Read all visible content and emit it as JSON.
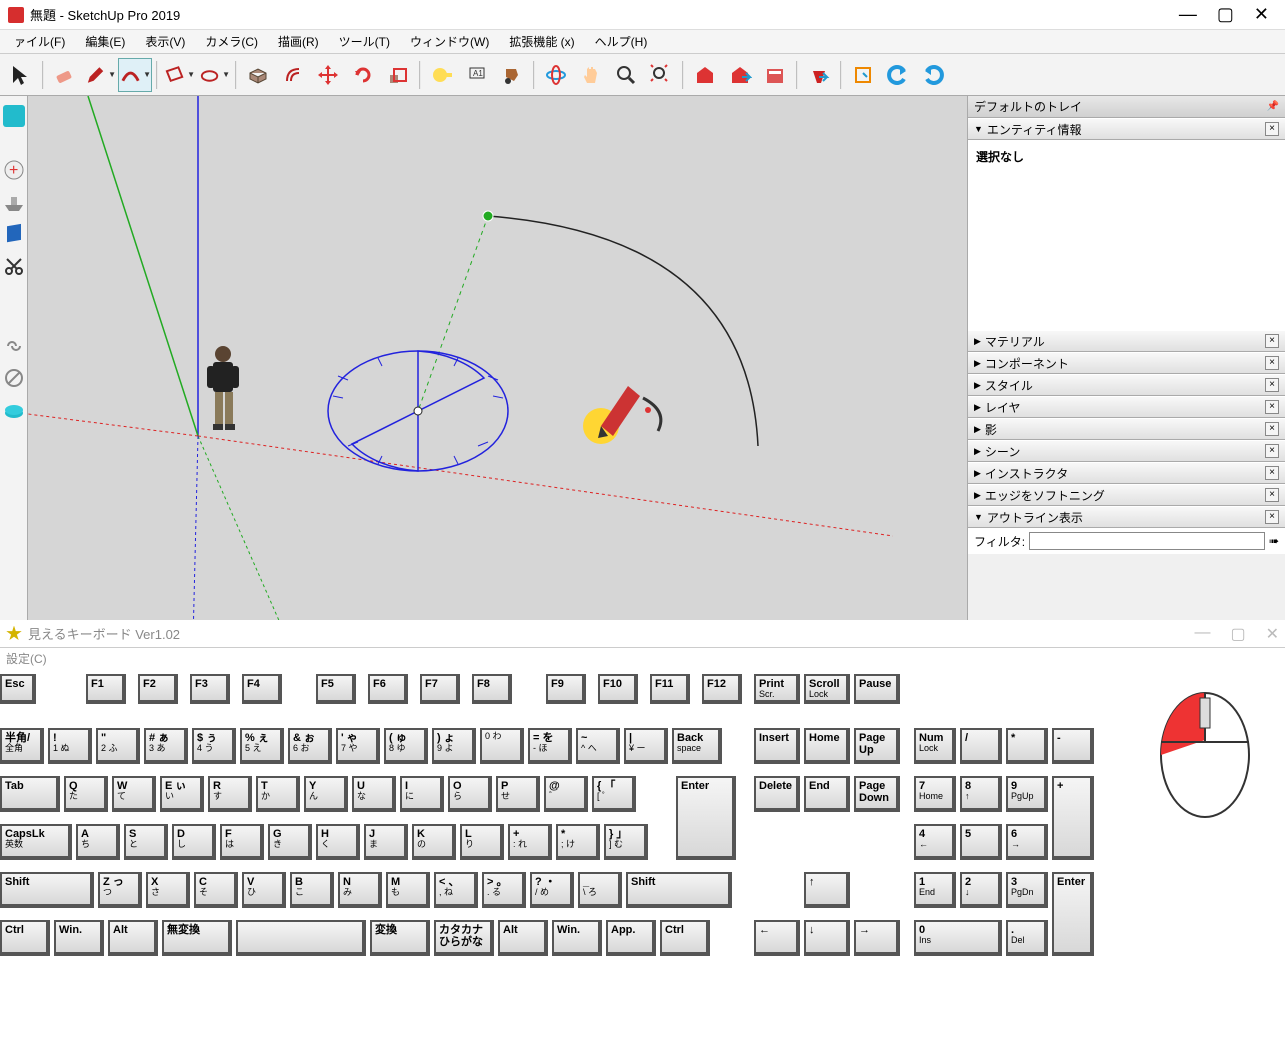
{
  "window": {
    "title": "無題 - SketchUp Pro 2019",
    "min": "—",
    "max": "▢",
    "close": "✕"
  },
  "menus": [
    {
      "id": "file",
      "label": "ァイル(F)"
    },
    {
      "id": "edit",
      "label": "編集(E)"
    },
    {
      "id": "view",
      "label": "表示(V)"
    },
    {
      "id": "camera",
      "label": "カメラ(C)"
    },
    {
      "id": "draw",
      "label": "描画(R)"
    },
    {
      "id": "tools",
      "label": "ツール(T)"
    },
    {
      "id": "window",
      "label": "ウィンドウ(W)"
    },
    {
      "id": "ext",
      "label": "拡張機能 (x)"
    },
    {
      "id": "help",
      "label": "ヘルプ(H)"
    }
  ],
  "tray": {
    "title": "デフォルトのトレイ",
    "entity_head": "エンティティ情報",
    "entity_body": "選択なし",
    "panels": [
      "マテリアル",
      "コンポーネント",
      "スタイル",
      "レイヤ",
      "影",
      "シーン",
      "インストラクタ",
      "エッジをソフトニング"
    ],
    "outline_head": "アウトライン表示",
    "filter": "フィルタ:"
  },
  "kb": {
    "title": "見えるキーボード Ver1.02",
    "menu": "設定(C)",
    "row_f": [
      "Esc",
      "F1",
      "F2",
      "F3",
      "F4",
      "F5",
      "F6",
      "F7",
      "F8",
      "F9",
      "F10",
      "F11",
      "F12"
    ],
    "row_f_right": [
      [
        "Print",
        "Scr."
      ],
      [
        "Scroll",
        "Lock"
      ],
      [
        "Pause",
        ""
      ]
    ],
    "row1": [
      [
        "半角/",
        "全角"
      ],
      [
        "!",
        "1 ぬ"
      ],
      [
        "\"",
        "2 ふ"
      ],
      [
        "# ぁ",
        "3 あ"
      ],
      [
        "$ ぅ",
        "4 う"
      ],
      [
        "% ぇ",
        "5 え"
      ],
      [
        "& ぉ",
        "6 お"
      ],
      [
        "' ゃ",
        "7 や"
      ],
      [
        "( ゅ",
        "8 ゆ"
      ],
      [
        ") ょ",
        "9 よ"
      ],
      [
        "",
        "0 わ"
      ],
      [
        "= を",
        "- ほ"
      ],
      [
        "~",
        "^ へ"
      ],
      [
        "|",
        "¥ ー"
      ]
    ],
    "backspace": [
      "Back",
      "space"
    ],
    "row1_nav": [
      "Insert",
      "Home",
      "Page\nUp"
    ],
    "row1_np": [
      [
        "Num",
        "Lock"
      ],
      [
        "/",
        ""
      ],
      [
        "*",
        ""
      ],
      [
        "-",
        ""
      ]
    ],
    "row2": [
      "Tab"
    ],
    "row2_keys": [
      [
        "Q",
        "た"
      ],
      [
        "W",
        "て"
      ],
      [
        "E ぃ",
        "い"
      ],
      [
        "R",
        "す"
      ],
      [
        "T",
        "か"
      ],
      [
        "Y",
        "ん"
      ],
      [
        "U",
        "な"
      ],
      [
        "I",
        "に"
      ],
      [
        "O",
        "ら"
      ],
      [
        "P",
        "せ"
      ],
      [
        "@",
        "゛"
      ],
      [
        "{ 「",
        "[  ゜"
      ]
    ],
    "enter": "Enter",
    "row2_nav": [
      "Delete",
      "End",
      "Page\nDown"
    ],
    "row2_np": [
      [
        "7",
        "Home"
      ],
      [
        "8",
        "↑"
      ],
      [
        "9",
        "PgUp"
      ]
    ],
    "row3": [
      [
        "CapsLk",
        "英数"
      ]
    ],
    "row3_keys": [
      [
        "A",
        "ち"
      ],
      [
        "S",
        "と"
      ],
      [
        "D",
        "し"
      ],
      [
        "F",
        "は"
      ],
      [
        "G",
        "き"
      ],
      [
        "H",
        "く"
      ],
      [
        "J",
        "ま"
      ],
      [
        "K",
        "の"
      ],
      [
        "L",
        "り"
      ],
      [
        "+",
        ": れ"
      ],
      [
        "*",
        "; け"
      ],
      [
        "} 」",
        "] む"
      ]
    ],
    "row3_np": [
      [
        "4",
        "←"
      ],
      [
        "5",
        ""
      ],
      [
        "6",
        "→"
      ]
    ],
    "np_plus": "+",
    "row4": [
      "Shift"
    ],
    "row4_keys": [
      [
        "Z っ",
        "つ"
      ],
      [
        "X",
        "さ"
      ],
      [
        "C",
        "そ"
      ],
      [
        "V",
        "ひ"
      ],
      [
        "B",
        "こ"
      ],
      [
        "N",
        "み"
      ],
      [
        "M",
        "も"
      ],
      [
        "< 、",
        ", ね"
      ],
      [
        "> 。",
        ". る"
      ],
      [
        "? ・",
        "/ め"
      ],
      [
        "_",
        "\\ ろ"
      ]
    ],
    "row4_r": "Shift",
    "row4_nav": "↑",
    "row4_np": [
      [
        "1",
        "End"
      ],
      [
        "2",
        "↓"
      ],
      [
        "3",
        "PgDn"
      ]
    ],
    "np_enter": "Enter",
    "row5": [
      "Ctrl",
      "Win.",
      "Alt",
      "無変換",
      "",
      "変換",
      "カタカナ\nひらがな",
      "Alt",
      "Win.",
      "App.",
      "Ctrl"
    ],
    "row5_nav": [
      "←",
      "↓",
      "→"
    ],
    "row5_np": [
      [
        "0",
        "Ins"
      ],
      [
        ".",
        "Del"
      ]
    ]
  }
}
